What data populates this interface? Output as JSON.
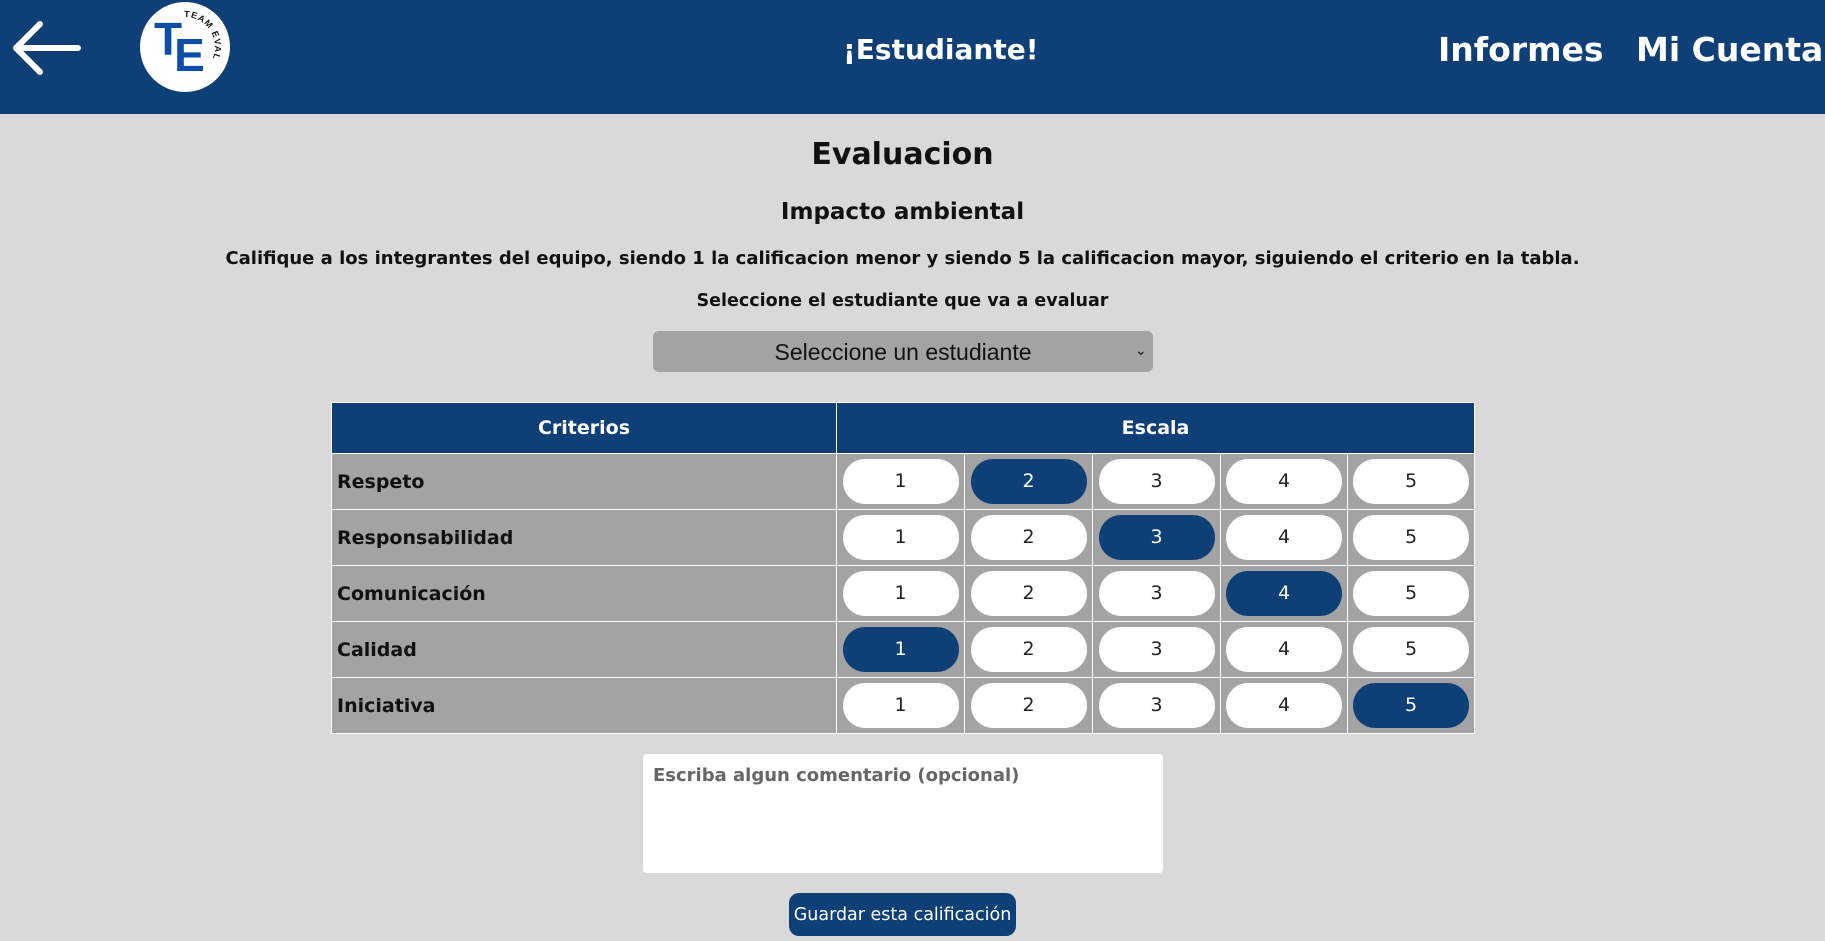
{
  "header": {
    "back_icon": "arrow-left-icon",
    "logo": {
      "letters_top": "T",
      "letters_bottom": "E",
      "arc_text": "TEAM EVAL"
    },
    "title": "¡Estudiante!",
    "links": {
      "informes": "Informes",
      "mi_cuenta": "Mi Cuenta"
    },
    "color": "#0e3f77"
  },
  "main": {
    "title": "Evaluacion",
    "project": "Impacto ambiental",
    "instructions": "Califique a los integrantes del equipo, siendo 1 la calificacion menor y siendo 5 la calificacion mayor, siguiendo el criterio en la tabla.",
    "select_label": "Seleccione el estudiante que va a evaluar",
    "select_value": "Seleccione un estudiante"
  },
  "table": {
    "headers": {
      "criteria": "Criterios",
      "scale": "Escala"
    },
    "scale_values": [
      "1",
      "2",
      "3",
      "4",
      "5"
    ],
    "rows": [
      {
        "criterion": "Respeto",
        "selected": 2
      },
      {
        "criterion": "Responsabilidad",
        "selected": 3
      },
      {
        "criterion": "Comunicación",
        "selected": 4
      },
      {
        "criterion": "Calidad",
        "selected": 1
      },
      {
        "criterion": "Iniciativa",
        "selected": 5
      }
    ],
    "selected_color": "#0e3f77"
  },
  "comment": {
    "placeholder": "Escriba algun comentario (opcional)",
    "value": ""
  },
  "save_button": "Guardar esta calificación"
}
